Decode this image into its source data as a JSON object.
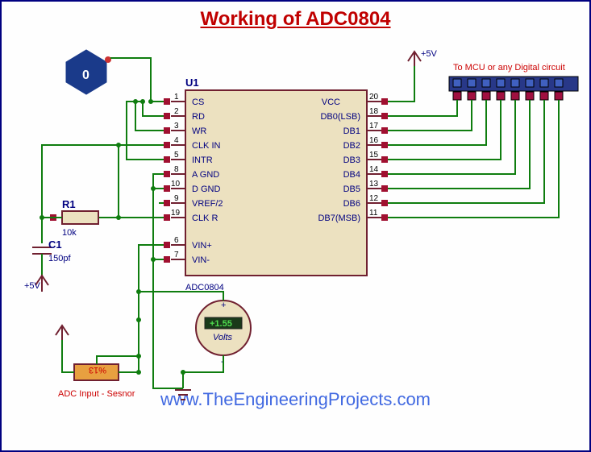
{
  "title": "Working of ADC0804",
  "watermark": "www.TheEngineeringProjects.com",
  "chip": {
    "ref": "U1",
    "part": "ADC0804",
    "left_pins": [
      {
        "n": "1",
        "name": "CS"
      },
      {
        "n": "2",
        "name": "RD"
      },
      {
        "n": "3",
        "name": "WR"
      },
      {
        "n": "4",
        "name": "CLK IN"
      },
      {
        "n": "5",
        "name": "INTR"
      },
      {
        "n": "8",
        "name": "A GND"
      },
      {
        "n": "10",
        "name": "D GND"
      },
      {
        "n": "9",
        "name": "VREF/2"
      },
      {
        "n": "19",
        "name": "CLK R"
      }
    ],
    "vin_pins": [
      {
        "n": "6",
        "name": "VIN+"
      },
      {
        "n": "7",
        "name": "VIN-"
      }
    ],
    "right_pins": [
      {
        "n": "20",
        "name": "VCC"
      },
      {
        "n": "18",
        "name": "DB0(LSB)"
      },
      {
        "n": "17",
        "name": "DB1"
      },
      {
        "n": "16",
        "name": "DB2"
      },
      {
        "n": "15",
        "name": "DB3"
      },
      {
        "n": "14",
        "name": "DB4"
      },
      {
        "n": "13",
        "name": "DB5"
      },
      {
        "n": "12",
        "name": "DB6"
      },
      {
        "n": "11",
        "name": "DB7(MSB)"
      }
    ]
  },
  "r1": {
    "ref": "R1",
    "val": "10k"
  },
  "c1": {
    "ref": "C1",
    "val": "150pf"
  },
  "vcc_label": "+5V",
  "mcu_label": "To MCU or any Digital circuit",
  "sensor_label": "ADC Input - Sesnor",
  "display_hex": "0",
  "meter": {
    "value": "+1.55",
    "unit": "Volts"
  },
  "sensor_pot": "%13"
}
